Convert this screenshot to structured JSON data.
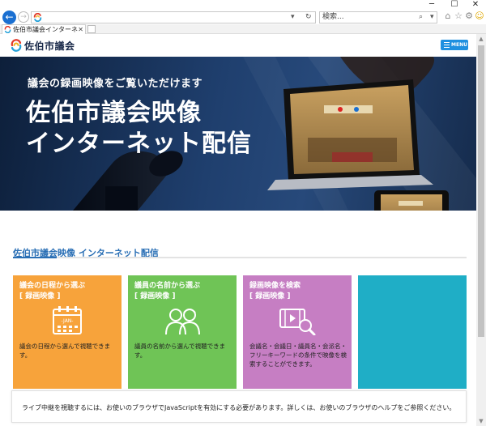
{
  "browser": {
    "search_placeholder": "検索...",
    "tab_title": "佐伯市議会インターネット議会...",
    "window_controls": [
      "─",
      "☐",
      "✕"
    ],
    "toolbar_icons": [
      "home-icon",
      "star-icon",
      "gear-icon",
      "smiley-icon"
    ]
  },
  "header": {
    "logo_text": "佐伯市議会",
    "menu_label": "MENU"
  },
  "hero": {
    "subtitle": "議会の録画映像をご覧いただけます",
    "title_line1": "佐伯市議会映像",
    "title_line2": "インターネット配信"
  },
  "section": {
    "title": "佐伯市議会映像 インターネット配信"
  },
  "cards": [
    {
      "title": "議会の日程から選ぶ",
      "tag": "[ 録画映像 ]",
      "icon": "calendar-icon",
      "icon_text": "-JAN-",
      "desc": "議会の日程から選んで視聴できます。",
      "color": "#f7a33b"
    },
    {
      "title": "議員の名前から選ぶ",
      "tag": "[ 録画映像 ]",
      "icon": "people-icon",
      "desc": "議員の名前から選んで視聴できます。",
      "color": "#6fc456"
    },
    {
      "title": "録画映像を検索",
      "tag": "[ 録画映像 ]",
      "icon": "video-search-icon",
      "desc": "会議名・会議日・議員名・会派名・フリーキーワードの条件で映像を検索することができます。",
      "color": "#c67ec3"
    },
    {
      "color": "#1faec6"
    }
  ],
  "notice": {
    "text": "ライブ中継を視聴するには、お使いのブラウザでJavaScriptを有効にする必要があります。詳しくは、お使いのブラウザのヘルプをご参照ください。"
  }
}
